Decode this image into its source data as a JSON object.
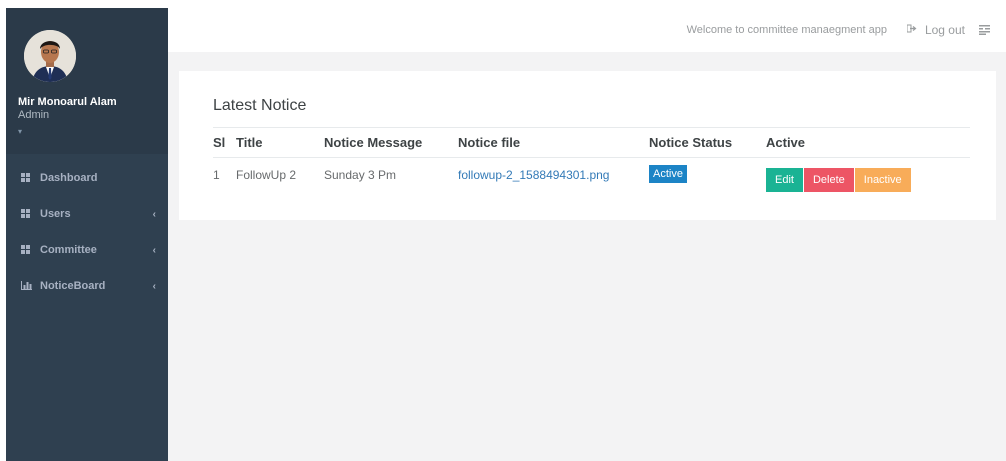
{
  "sidebar": {
    "profile": {
      "name": "Mir Monoarul Alam",
      "role": "Admin",
      "caret": "▾"
    },
    "items": [
      {
        "label": "Dashboard",
        "icon": "grid-icon",
        "has_submenu": false
      },
      {
        "label": "Users",
        "icon": "grid-icon",
        "has_submenu": true
      },
      {
        "label": "Committee",
        "icon": "grid-icon",
        "has_submenu": true
      },
      {
        "label": "NoticeBoard",
        "icon": "bar-chart-icon",
        "has_submenu": true
      }
    ],
    "chevron": "‹"
  },
  "topbar": {
    "welcome": "Welcome to committee manaegment app",
    "logout": "Log out"
  },
  "notice": {
    "title": "Latest Notice",
    "columns": [
      "Sl",
      "Title",
      "Notice Message",
      "Notice file",
      "Notice Status",
      "Active"
    ],
    "rows": [
      {
        "sl": "1",
        "title": "FollowUp 2",
        "message": "Sunday 3 Pm",
        "file": "followup-2_1588494301.png",
        "status": "Active",
        "actions": {
          "edit": "Edit",
          "delete": "Delete",
          "inactive": "Inactive"
        }
      }
    ]
  },
  "colors": {
    "sidebar": "#2f4050",
    "edit": "#1ab394",
    "delete": "#ed5565",
    "inactive": "#f8ac59",
    "status": "#1c84c6"
  }
}
